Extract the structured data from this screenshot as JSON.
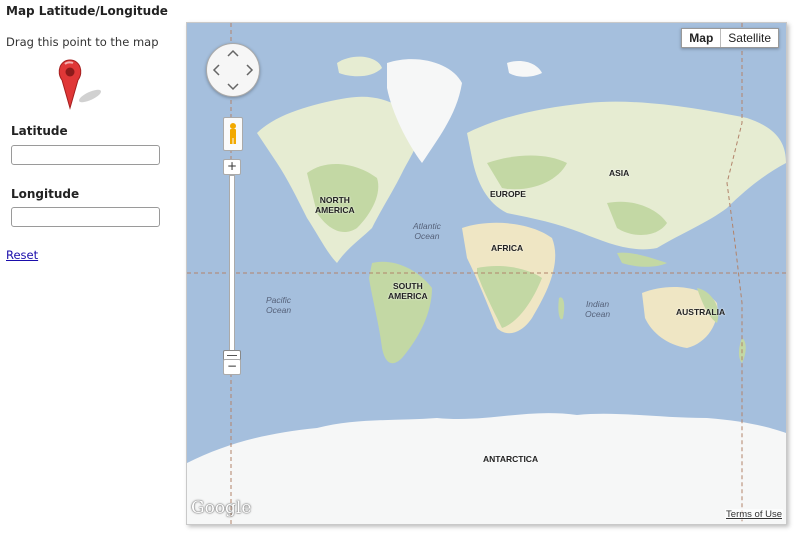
{
  "page": {
    "title": "Map Latitude/Longitude",
    "hint": "Drag this point to the map",
    "latitude_label": "Latitude",
    "latitude_value": "",
    "longitude_label": "Longitude",
    "longitude_value": "",
    "reset_label": "Reset"
  },
  "map": {
    "map_type_options": [
      "Map",
      "Satellite"
    ],
    "selected_map_type": "Map",
    "continent_labels": {
      "north_america": "NORTH\nAMERICA",
      "europe": "EUROPE",
      "asia": "ASIA",
      "africa": "AFRICA",
      "south_america": "SOUTH\nAMERICA",
      "australia": "AUSTRALIA",
      "antarctica": "ANTARCTICA"
    },
    "ocean_labels": {
      "atlantic": "Atlantic\nOcean",
      "pacific": "Pacific\nOcean",
      "indian": "Indian\nOcean"
    },
    "zoom_in": "+",
    "zoom_out": "−",
    "logo": "Google",
    "terms": "Terms of Use",
    "colors": {
      "water": "#a5bfdd",
      "land": "#e6ecd2",
      "forest": "#c3d8a4",
      "desert": "#efe6c4",
      "ice": "#f6f7f7"
    }
  }
}
